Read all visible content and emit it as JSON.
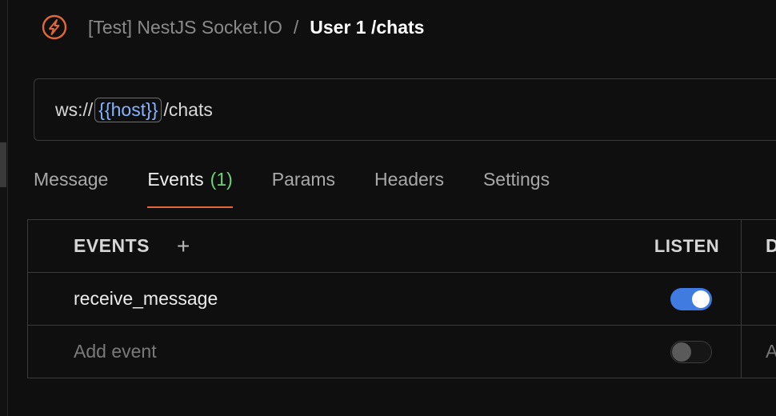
{
  "breadcrumb": {
    "logo_icon": "socketio-logo-icon",
    "collection": "[Test] NestJS Socket.IO",
    "separator": "/",
    "current": "User 1 /chats"
  },
  "url": {
    "prefix": "ws://",
    "variable": "{{host}}",
    "suffix": "/chats"
  },
  "tabs": [
    {
      "label": "Message",
      "active": false
    },
    {
      "label": "Events",
      "count": "(1)",
      "active": true
    },
    {
      "label": "Params",
      "active": false
    },
    {
      "label": "Headers",
      "active": false
    },
    {
      "label": "Settings",
      "active": false
    }
  ],
  "events_table": {
    "columns": {
      "events": "EVENTS",
      "listen": "LISTEN",
      "extra": "D"
    },
    "add_column_icon": "plus-icon",
    "rows": [
      {
        "name": "receive_message",
        "listen": true,
        "extra": ""
      }
    ],
    "new_row": {
      "placeholder": "Add event",
      "listen": false,
      "extra_placeholder": "A"
    }
  },
  "colors": {
    "accent": "#e0683a",
    "toggle_on": "#3f7be0",
    "count": "#6fd27a",
    "variable": "#86b3ff"
  }
}
